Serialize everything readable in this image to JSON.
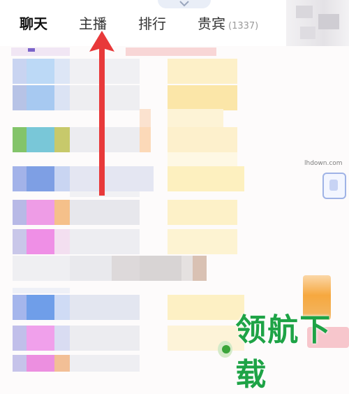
{
  "tabs": [
    {
      "label": "聊天",
      "active": true
    },
    {
      "label": "主播",
      "active": false
    },
    {
      "label": "排行",
      "active": false
    },
    {
      "label": "贵宾",
      "count": "(1337)",
      "active": false
    }
  ],
  "pull_handle_icon": "chevron-down-icon",
  "annotation_icon": "red-arrow-up-icon",
  "watermark": {
    "url": "lhdown.com",
    "text": "领航下载",
    "logo_icon": "lhdown-logo-icon"
  },
  "colors": {
    "arrow": "#e8393a",
    "watermark_green": "#1ea346",
    "active_tab_text": "#111111",
    "count_text": "#9a9a9a"
  }
}
